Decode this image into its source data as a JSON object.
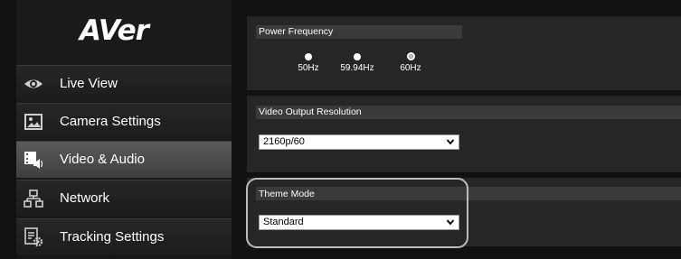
{
  "logo_text": "AVer",
  "sidebar": {
    "items": [
      {
        "label": "Live View",
        "icon": "eye-icon",
        "active": false
      },
      {
        "label": "Camera Settings",
        "icon": "image-icon",
        "active": false
      },
      {
        "label": "Video & Audio",
        "icon": "video-audio-icon",
        "active": true
      },
      {
        "label": "Network",
        "icon": "network-icon",
        "active": false
      },
      {
        "label": "Tracking Settings",
        "icon": "tracking-settings-icon",
        "active": false
      }
    ]
  },
  "power_frequency": {
    "title": "Power Frequency",
    "options": [
      "50Hz",
      "59.94Hz",
      "60Hz"
    ],
    "selected": "60Hz"
  },
  "video_output": {
    "title": "Video Output Resolution",
    "value": "2160p/60"
  },
  "theme_mode": {
    "title": "Theme Mode",
    "value": "Standard"
  },
  "colors": {
    "background": "#111111",
    "panel": "#262626",
    "active_nav": "#5a5a5a",
    "highlight_border": "#bdbdbd"
  }
}
